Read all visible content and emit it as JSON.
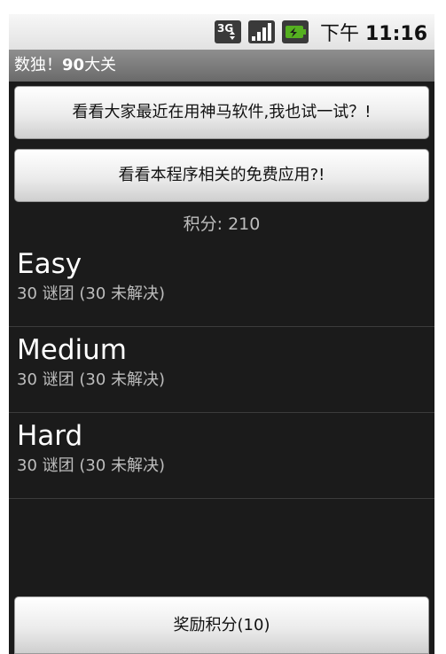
{
  "status_bar": {
    "network_label": "3G",
    "time_prefix": "下午",
    "time": "11:16",
    "icons": [
      "network-3g-icon",
      "signal-strength-icon",
      "battery-charging-icon"
    ]
  },
  "title_bar": {
    "title_prefix": "数独！",
    "title_bold": "90",
    "title_suffix": "大关"
  },
  "buttons": {
    "promo_label": "看看大家最近在用神马软件,我也试一试？!",
    "free_apps_label": "看看本程序相关的免费应用?!",
    "bonus_label": "奖励积分(10)"
  },
  "score": {
    "text": "积分: 210"
  },
  "levels": [
    {
      "name": "Easy",
      "desc": "30 谜团 (30 未解决)"
    },
    {
      "name": "Medium",
      "desc": "30 谜团 (30 未解决)"
    },
    {
      "name": "Hard",
      "desc": "30 谜团 (30 未解决)"
    }
  ],
  "colors": {
    "background": "#1b1b1b",
    "title_bar": "#7a7a7a",
    "status_bar": "#ececec",
    "battery_accent": "#55b020"
  }
}
